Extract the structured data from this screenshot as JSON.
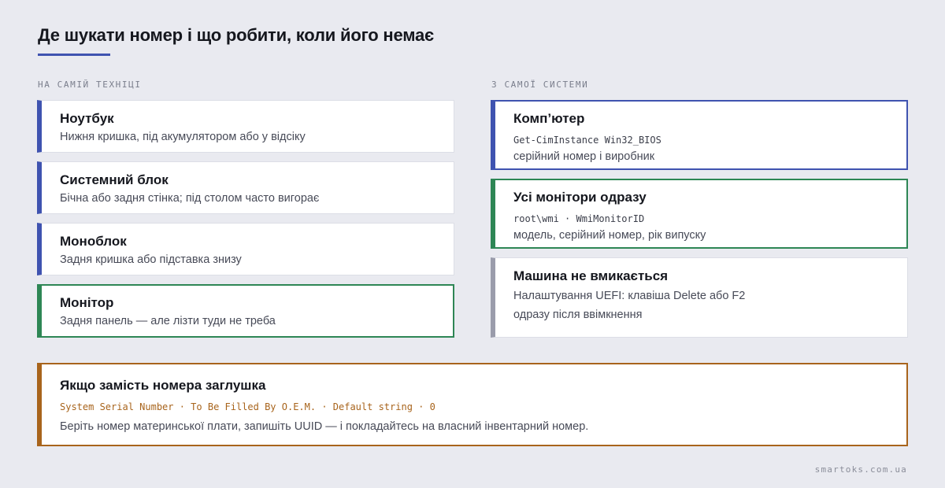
{
  "title": "Де шукати номер і що робити, коли його немає",
  "left_section": {
    "label": "НА САМІЙ ТЕХНІЦІ",
    "cards": [
      {
        "title": "Ноутбук",
        "text": "Нижня кришка, під акумулятором або у відсіку"
      },
      {
        "title": "Системний блок",
        "text": "Бічна або задня стінка; під столом часто вигорає"
      },
      {
        "title": "Моноблок",
        "text": "Задня кришка або підставка знизу"
      },
      {
        "title": "Монітор",
        "text": "Задня панель — але лізти туди не треба"
      }
    ]
  },
  "right_section": {
    "label": "З САМОЇ СИСТЕМИ",
    "cards": [
      {
        "title": "Комп’ютер",
        "code": "Get-CimInstance Win32_BIOS",
        "text": "серійний номер і виробник"
      },
      {
        "title": "Усі монітори одразу",
        "code": "root\\wmi · WmiMonitorID",
        "text": "модель, серійний номер, рік випуску"
      },
      {
        "title": "Машина не вмикається",
        "text": "Налаштування UEFI: клавіша Delete або F2",
        "text2": "одразу після ввімкнення"
      }
    ]
  },
  "placeholder_card": {
    "title": "Якщо замість номера заглушка",
    "code": "System Serial Number · To Be Filled By O.E.M. · Default string · 0",
    "text": "Беріть номер материнської плати, запишіть UUID — і покладайтесь на власний інвентарний номер."
  },
  "footer": "smartoks.com.ua",
  "colors": {
    "accent_blue": "#3f53b0",
    "accent_green": "#2e8655",
    "accent_gray": "#9a9cab",
    "accent_orange": "#a8641c",
    "background": "#e9eaf0"
  }
}
